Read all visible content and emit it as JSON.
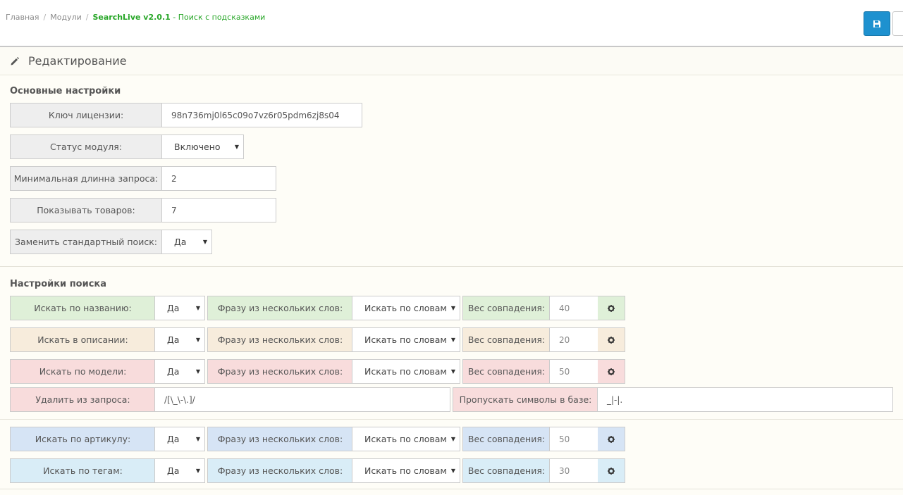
{
  "breadcrumb": {
    "home": "Главная",
    "modules": "Модули",
    "module": "SearchLive v2.0.1",
    "module_sub": " - Поиск с подсказками"
  },
  "panel": {
    "title": "Редактирование"
  },
  "main_settings": {
    "title": "Основные настройки",
    "license_label": "Ключ лицензии:",
    "license_value": "98n736mj0l65c09o7vz6r05pdm6zj8s04",
    "status_label": "Статус модуля:",
    "status_value": "Включено",
    "minlen_label": "Минимальная длинна запроса:",
    "minlen_value": "2",
    "show_label": "Показывать товаров:",
    "show_value": "7",
    "replace_label": "Заменить стандартный поиск:",
    "replace_value": "Да"
  },
  "search_settings": {
    "title": "Настройки поиска",
    "rows": [
      {
        "label": "Искать по названию:",
        "value": "Да",
        "phrase_label": "Фразу из нескольких слов:",
        "phrase_value": "Искать по словам",
        "weight_label": "Вес совпадения:",
        "weight_value": "40"
      },
      {
        "label": "Искать в описании:",
        "value": "Да",
        "phrase_label": "Фразу из нескольких слов:",
        "phrase_value": "Искать по словам",
        "weight_label": "Вес совпадения:",
        "weight_value": "20"
      },
      {
        "label": "Искать по модели:",
        "value": "Да",
        "phrase_label": "Фразу из нескольких слов:",
        "phrase_value": "Искать по словам",
        "weight_label": "Вес совпадения:",
        "weight_value": "50"
      },
      {
        "label": "Искать по артикулу:",
        "value": "Да",
        "phrase_label": "Фразу из нескольких слов:",
        "phrase_value": "Искать по словам",
        "weight_label": "Вес совпадения:",
        "weight_value": "50"
      },
      {
        "label": "Искать по тегам:",
        "value": "Да",
        "phrase_label": "Фразу из нескольких слов:",
        "phrase_value": "Искать по словам",
        "weight_label": "Вес совпадения:",
        "weight_value": "30"
      }
    ],
    "remove_label": "Удалить из запроса:",
    "remove_value": "/[\\_\\-\\.]/",
    "skip_label": "Пропускать символы в базе:",
    "skip_value": "_|-|."
  },
  "icons": {
    "save": "save-icon",
    "edit": "pencil-icon",
    "settings": "gear-icon"
  },
  "colors": {
    "primary": "#1e91cf",
    "breadcrumb_active": "#27a627",
    "green_row": "#dff0d8",
    "beige_row": "#f7ecdc",
    "pink_row": "#f8dcdc",
    "blue_row": "#d6e4f5",
    "light_blue_row": "#d9edf7"
  }
}
